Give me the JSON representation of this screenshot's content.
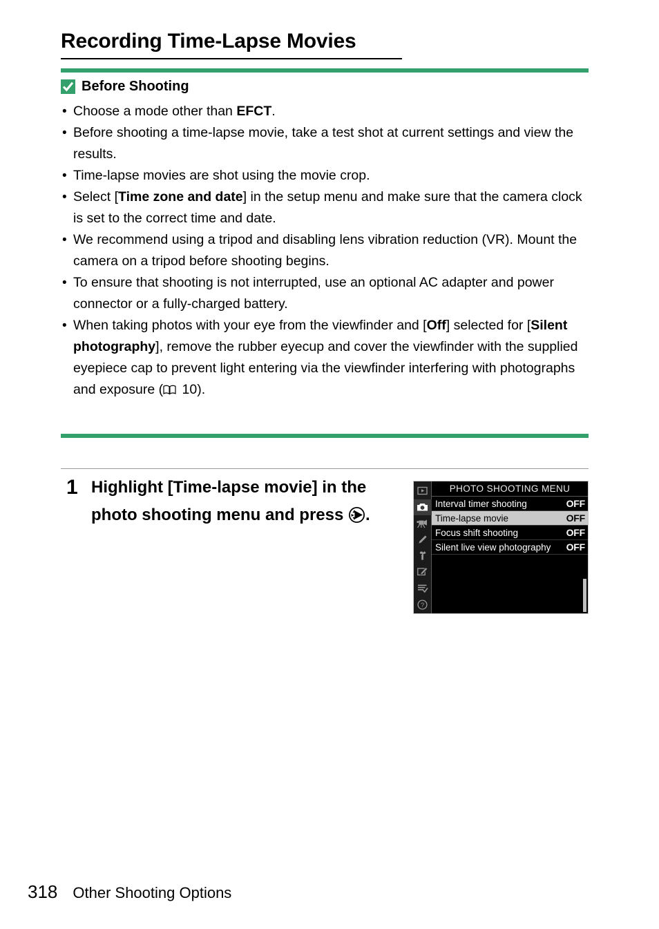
{
  "page": {
    "title": "Recording Time-Lapse Movies",
    "number": "318",
    "section": "Other Shooting Options",
    "accent_color": "#34a06b"
  },
  "before_shooting": {
    "icon": "green-check-badge",
    "heading": "Before Shooting",
    "bullet_marker": "•",
    "bullets": [
      {
        "parts": [
          {
            "type": "text",
            "text": "Choose a mode other than "
          },
          {
            "type": "bold",
            "text": "EFCT"
          },
          {
            "type": "text",
            "text": "."
          }
        ]
      },
      {
        "parts": [
          {
            "type": "text",
            "text": "Before shooting a time-lapse movie, take a test shot at current settings and view the results."
          }
        ]
      },
      {
        "parts": [
          {
            "type": "text",
            "text": "Time-lapse movies are shot using the movie crop."
          }
        ]
      },
      {
        "parts": [
          {
            "type": "text",
            "text": "Select ["
          },
          {
            "type": "bold",
            "text": "Time zone and date"
          },
          {
            "type": "text",
            "text": "] in the setup menu and make sure that the camera clock is set to the correct time and date."
          }
        ]
      },
      {
        "parts": [
          {
            "type": "text",
            "text": "We recommend using a tripod and disabling lens vibration reduction (VR). Mount the camera on a tripod before shooting begins."
          }
        ]
      },
      {
        "parts": [
          {
            "type": "text",
            "text": "To ensure that shooting is not interrupted, use an optional AC adapter and power connector or a fully-charged battery."
          }
        ]
      },
      {
        "parts": [
          {
            "type": "text",
            "text": "When taking photos with your eye from the viewfinder and ["
          },
          {
            "type": "bold",
            "text": "Off"
          },
          {
            "type": "text",
            "text": "] selected for ["
          },
          {
            "type": "bold",
            "text": "Silent photography"
          },
          {
            "type": "text",
            "text": "], remove the rubber eyecup and cover the viewfinder with the supplied eyepiece cap to prevent light entering via the viewfinder interfering with photographs and exposure ("
          },
          {
            "type": "icon",
            "icon": "book-icon"
          },
          {
            "type": "text",
            "text": " 10)."
          }
        ]
      }
    ]
  },
  "step": {
    "number": "1",
    "parts": [
      {
        "type": "text",
        "text": "Highlight [Time-lapse movie] in the photo shooting menu and press "
      },
      {
        "type": "icon",
        "icon": "multi-selector-right-icon"
      },
      {
        "type": "text",
        "text": "."
      }
    ]
  },
  "camera_menu": {
    "title": "PHOTO SHOOTING MENU",
    "sidebar_icons": [
      {
        "name": "playback-icon",
        "active": false
      },
      {
        "name": "photo-shooting-menu-icon",
        "active": true
      },
      {
        "name": "movie-shooting-menu-icon",
        "active": false
      },
      {
        "name": "custom-settings-icon",
        "active": false
      },
      {
        "name": "setup-menu-icon",
        "active": false
      },
      {
        "name": "retouch-menu-icon",
        "active": false
      },
      {
        "name": "my-menu-icon",
        "active": false
      },
      {
        "name": "help-icon",
        "active": false
      }
    ],
    "rows": [
      {
        "label": "Interval timer shooting",
        "value": "OFF",
        "highlighted": false
      },
      {
        "label": "Time-lapse movie",
        "value": "OFF",
        "highlighted": true
      },
      {
        "label": "Focus shift shooting",
        "value": "OFF",
        "highlighted": false
      },
      {
        "label": "Silent live view photography",
        "value": "OFF",
        "highlighted": false
      }
    ],
    "scrollbar": "vertical-scrollbar"
  }
}
